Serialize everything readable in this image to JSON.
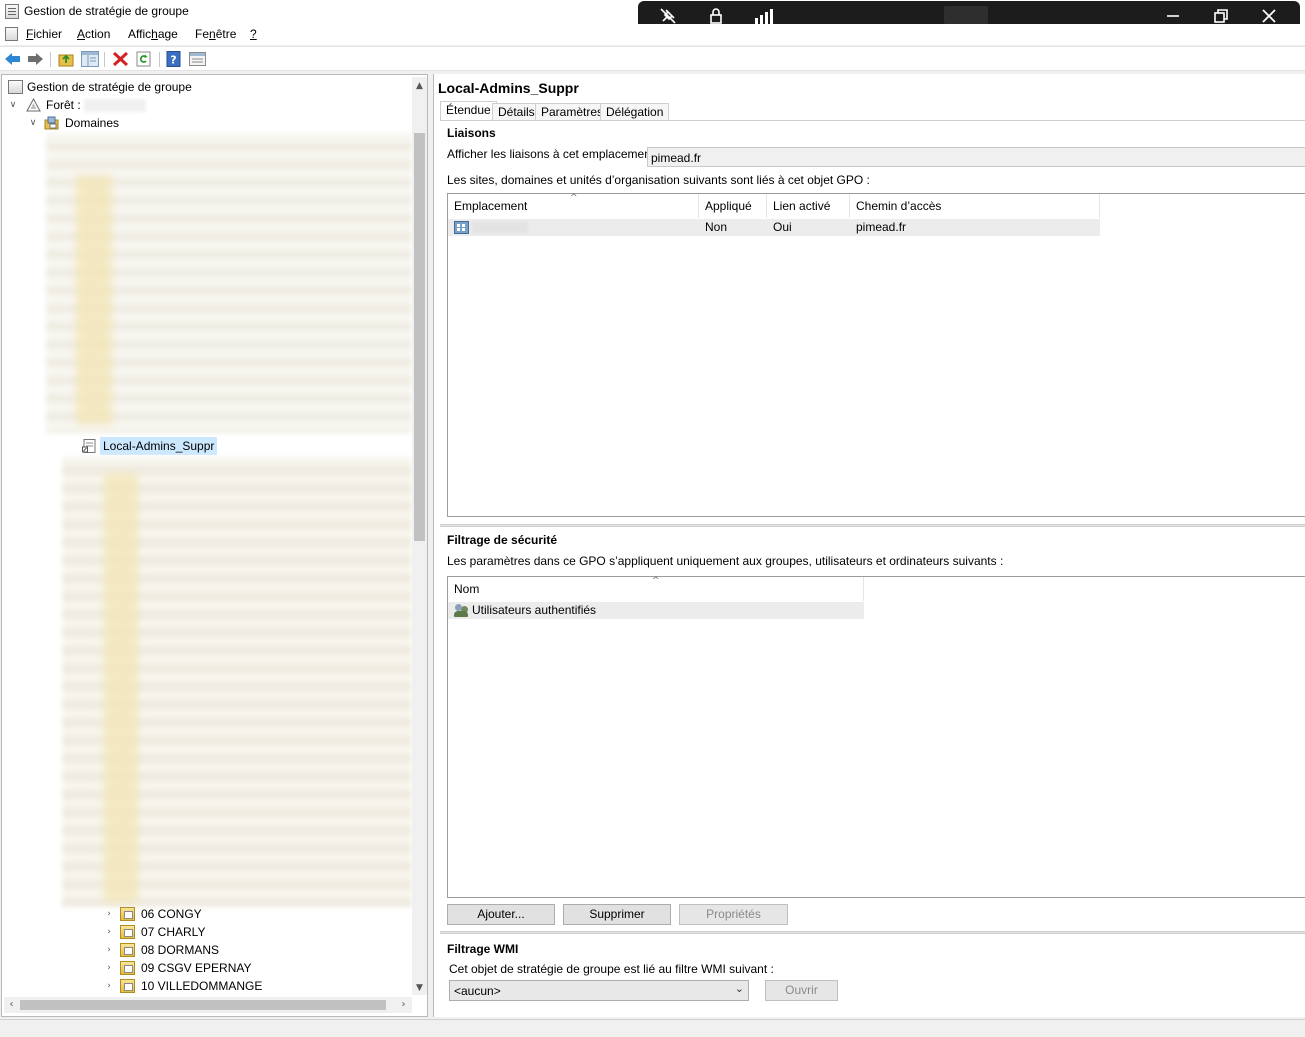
{
  "window": {
    "title": "Gestion de stratégie de groupe"
  },
  "rdbar": {
    "icons": [
      "unpin-icon",
      "lock-icon",
      "signal-icon",
      "minimize-icon",
      "restore-icon",
      "close-icon"
    ]
  },
  "menu": {
    "items": [
      {
        "label": "Fichier",
        "mnemonic": "F"
      },
      {
        "label": "Action",
        "mnemonic": "A"
      },
      {
        "label": "Affichage",
        "mnemonic": "h"
      },
      {
        "label": "Fenêtre",
        "mnemonic": "n"
      },
      {
        "label": "?",
        "mnemonic": "?"
      }
    ]
  },
  "toolbar": {
    "buttons": [
      "back-icon",
      "forward-icon",
      "up-folder-icon",
      "show-hide-tree-icon",
      "delete-icon",
      "refresh-icon",
      "help-icon",
      "properties-icon"
    ]
  },
  "tree": {
    "root": "Gestion de stratégie de groupe",
    "forest_label": "Forêt :",
    "domains_label": "Domaines",
    "selected": "Local-Admins_Suppr",
    "bottom_items": [
      "06 CONGY",
      "07 CHARLY",
      "08 DORMANS",
      "09 CSGV EPERNAY",
      "10 VILLEDOMMANGE"
    ]
  },
  "gpo": {
    "title": "Local-Admins_Suppr",
    "tabs": [
      "Étendue",
      "Détails",
      "Paramètres",
      "Délégation"
    ],
    "active_tab": "Étendue",
    "links": {
      "section_title": "Liaisons",
      "location_label": "Afficher les liaisons à cet emplacement :",
      "location_value": "pimead.fr",
      "description": "Les sites, domaines et unités d’organisation suivants sont liés à cet objet GPO :",
      "columns": [
        "Emplacement",
        "Appliqué",
        "Lien activé",
        "Chemin d’accès"
      ],
      "rows": [
        {
          "location": "",
          "enforced": "Non",
          "enabled": "Oui",
          "path": "pimead.fr"
        }
      ]
    },
    "security": {
      "section_title": "Filtrage de sécurité",
      "description": "Les paramètres dans ce GPO s’appliquent uniquement aux groupes, utilisateurs et ordinateurs suivants :",
      "columns": [
        "Nom"
      ],
      "rows": [
        {
          "name": "Utilisateurs authentifiés"
        }
      ],
      "buttons": {
        "add": "Ajouter...",
        "remove": "Supprimer",
        "properties": "Propriétés"
      }
    },
    "wmi": {
      "section_title": "Filtrage WMI",
      "description": "Cet objet de stratégie de groupe est lié au filtre WMI suivant :",
      "selected": "<aucun>",
      "open_button": "Ouvrir"
    }
  }
}
